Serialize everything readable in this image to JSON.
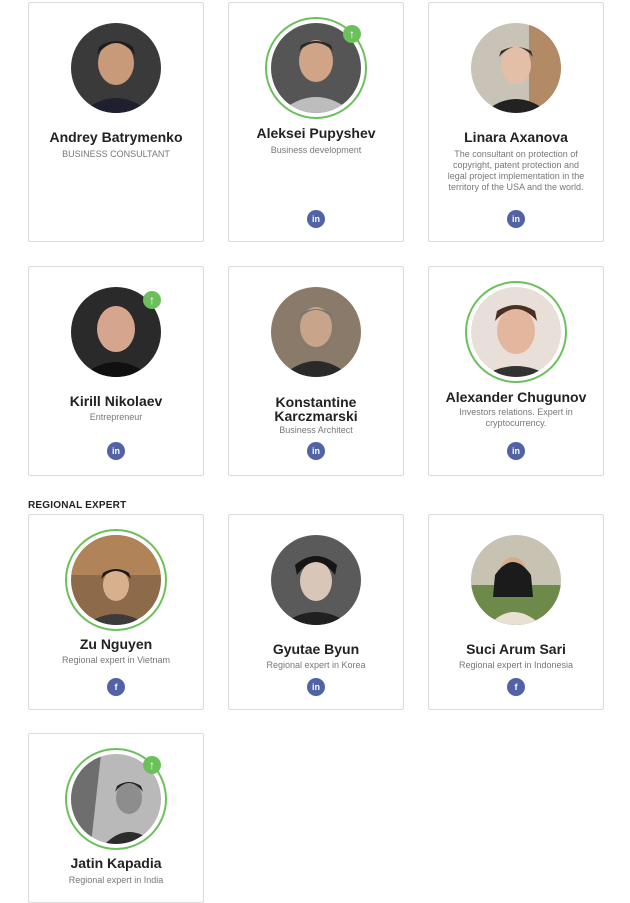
{
  "section_label": "REGIONAL EXPERT",
  "colors": {
    "ring": "#6cc05c",
    "social": "#5262a6",
    "border": "#dcdcdc"
  },
  "people": [
    {
      "name": "Andrey Batrymenko",
      "role": "BUSINESS CONSULTANT"
    },
    {
      "name": "Aleksei Pupyshev",
      "role": "Business development",
      "social": "in"
    },
    {
      "name": "Linara Axanova",
      "role": "The consultant on protection of copyright, patent protection and legal project implementation in the territory of the USA and the world.",
      "social": "in"
    },
    {
      "name": "Kirill Nikolaev",
      "role": "Entrepreneur",
      "social": "in"
    },
    {
      "name": "Konstantine Karczmarski",
      "role": "Business Architect",
      "social": "in"
    },
    {
      "name": "Alexander Chugunov",
      "role": "Investors relations. Expert in cryptocurrency.",
      "social": "in"
    },
    {
      "name": "Zu Nguyen",
      "role": "Regional expert in Vietnam",
      "social": "f"
    },
    {
      "name": "Gyutae Byun",
      "role": "Regional expert in Korea",
      "social": "in"
    },
    {
      "name": "Suci Arum Sari",
      "role": "Regional expert in Indonesia",
      "social": "f"
    },
    {
      "name": "Jatin Kapadia",
      "role": "Regional expert in India"
    }
  ],
  "badges": {
    "upvote": "↑"
  }
}
